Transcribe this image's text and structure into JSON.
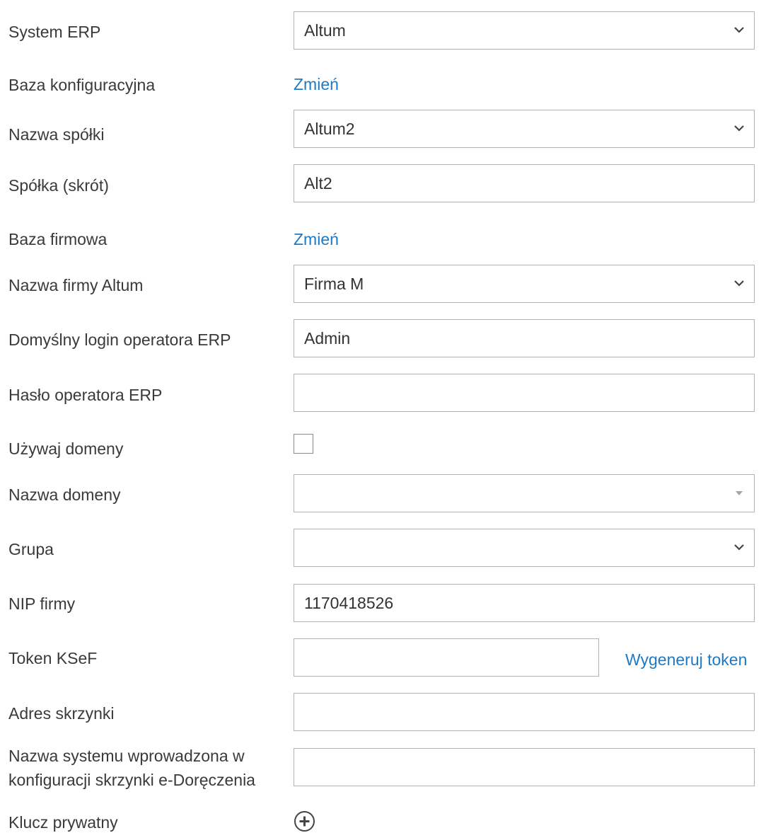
{
  "form": {
    "system_erp": {
      "label": "System ERP",
      "value": "Altum"
    },
    "baza_konfiguracyjna": {
      "label": "Baza konfiguracyjna",
      "link": "Zmień"
    },
    "nazwa_spolki": {
      "label": "Nazwa spółki",
      "value": "Altum2"
    },
    "spolka_skrot": {
      "label": "Spółka (skrót)",
      "value": "Alt2"
    },
    "baza_firmowa": {
      "label": "Baza firmowa",
      "link": "Zmień"
    },
    "nazwa_firmy_altum": {
      "label": "Nazwa firmy Altum",
      "value": "Firma M"
    },
    "domyslny_login": {
      "label": "Domyślny login operatora ERP",
      "value": "Admin"
    },
    "haslo_operatora": {
      "label": "Hasło operatora ERP",
      "value": ""
    },
    "uzywaj_domeny": {
      "label": "Używaj domeny",
      "checked": false
    },
    "nazwa_domeny": {
      "label": "Nazwa domeny",
      "value": ""
    },
    "grupa": {
      "label": "Grupa",
      "value": ""
    },
    "nip_firmy": {
      "label": "NIP firmy",
      "value": "1170418526"
    },
    "token_ksef": {
      "label": "Token KSeF",
      "value": "",
      "link": "Wygeneruj token"
    },
    "adres_skrzynki": {
      "label": "Adres skrzynki",
      "value": ""
    },
    "nazwa_systemu": {
      "label": "Nazwa systemu wprowadzona w konfiguracji skrzynki e-Doręczenia",
      "value": ""
    },
    "klucz_prywatny": {
      "label": "Klucz prywatny",
      "add_icon": "plus-circle-icon"
    }
  },
  "colors": {
    "link": "#1f7ac3",
    "border": "#b3b3b3",
    "text": "#333333"
  }
}
